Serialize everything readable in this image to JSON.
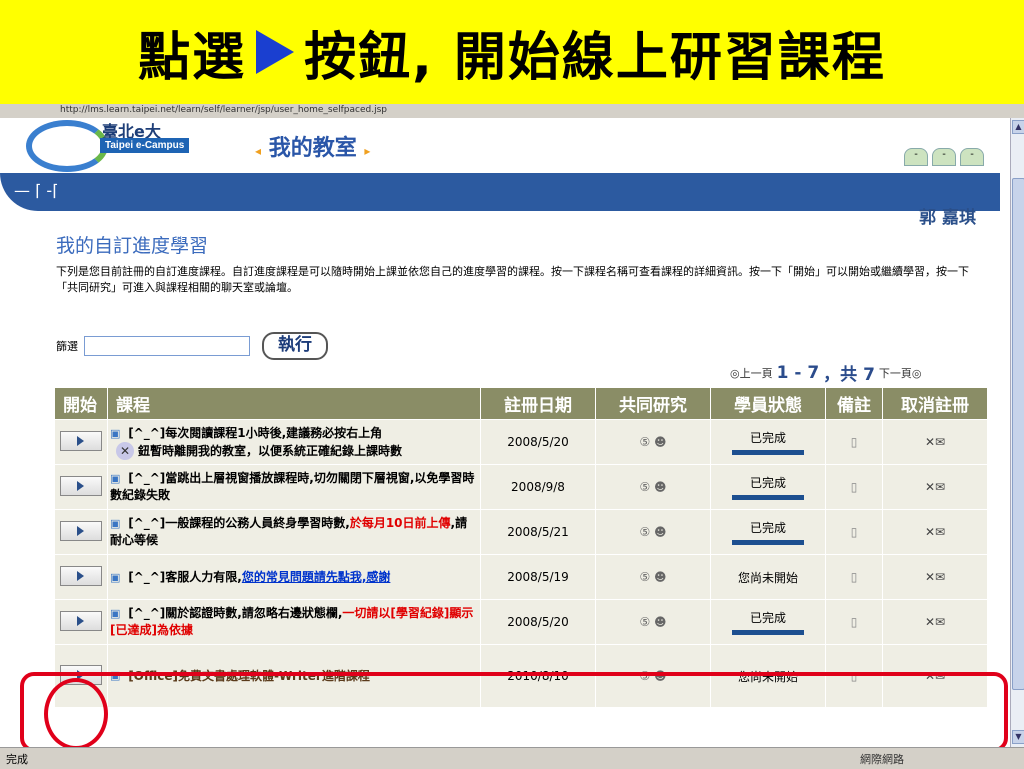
{
  "banner": {
    "text_before": "點選",
    "text_after": "按鈕,  開始線上研習課程"
  },
  "browser": {
    "address": "http://lms.learn.taipei.net/learn/self/learner/jsp/user_home_selfpaced.jsp",
    "status_left": "完成",
    "status_right": "網際網路"
  },
  "header": {
    "logo_text": "臺北e大",
    "logo_badge": "Taipei e-Campus",
    "room_title": "我的教室",
    "user_name": "郭 嘉琪"
  },
  "page": {
    "title": "我的自訂進度學習",
    "description": "下列是您目前註冊的自訂進度課程。自訂進度課程是可以隨時開始上課並依您自己的進度學習的課程。按一下課程名稱可查看課程的詳細資訊。按一下「開始」可以開始或繼續學習，按一下「共同研究」可進入與課程相關的聊天室或論壇。"
  },
  "filter": {
    "label": "篩選",
    "value": "",
    "button": "執行"
  },
  "pager": {
    "prev": "◎上一頁",
    "range": "1 - 7",
    "total": "，共 7",
    "next": "下一頁◎"
  },
  "table": {
    "headers": [
      "開始",
      "課程",
      "註冊日期",
      "共同研究",
      "學員狀態",
      "備註",
      "取消註冊"
    ]
  },
  "rows": [
    {
      "course": "[^_^]每次閱讀課程1小時後,建議務必按右上角",
      "course_extra": "鈕暫時離開我的教室，以便系統正確紀錄上課時數",
      "date": "2008/5/20",
      "status": "已完成"
    },
    {
      "course": "[^_^]當跳出上層視窗播放課程時,切勿關閉下層視窗,以免學習時數紀錄失敗",
      "date": "2008/9/8",
      "status": "已完成"
    },
    {
      "course": "[^_^]一般課程的公務人員終身學習時數,",
      "course_red": "於每月10日前上傳",
      "course_tail": ",請耐心等候",
      "date": "2008/5/21",
      "status": "已完成"
    },
    {
      "course": "[^_^]客服人力有限,",
      "course_link": "您的常見問題請先點我,感謝",
      "date": "2008/5/19",
      "status": "您尚未開始"
    },
    {
      "course": "[^_^]關於認證時數,請忽略右邊狀態欄,",
      "course_red": "一切請以[學習紀錄]顯示[已達成]為依據",
      "date": "2008/5/20",
      "status": "已完成"
    },
    {
      "course": "[Office]免費文書處理軟體-Writer進階課程",
      "date": "2010/8/10",
      "status": "您尚未開始"
    }
  ],
  "icons": {
    "discuss": "⑤ ☻",
    "note": "▯",
    "cancel": "✕✉"
  },
  "colors": {
    "banner": "#ffff00",
    "nav": "#2c5aa0",
    "table_header": "#8a8d66",
    "highlight": "#e0001a"
  }
}
